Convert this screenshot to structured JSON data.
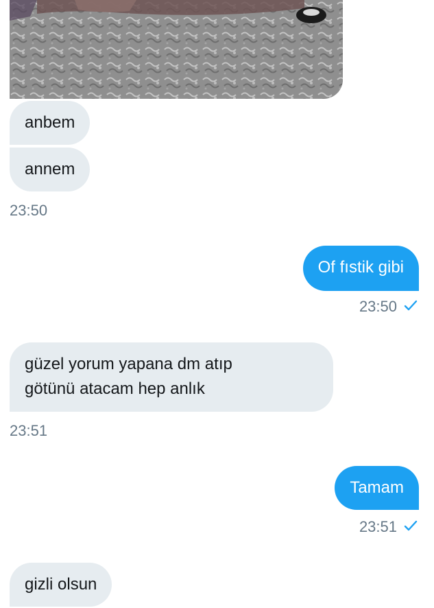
{
  "conversation": {
    "image_message": {
      "label": "photo-attachment"
    },
    "messages": [
      {
        "text": "anbem"
      },
      {
        "text": "annem"
      },
      {
        "time": "23:50"
      },
      {
        "text": "Of fıstik gibi",
        "time": "23:50"
      },
      {
        "line1": "güzel yorum yapana dm atıp",
        "line2": "götünü atacam hep anlık",
        "time": "23:51"
      },
      {
        "text": "Tamam",
        "time": "23:51"
      },
      {
        "text": "gizli olsun"
      }
    ]
  },
  "colors": {
    "incoming_bg": "#e6ecf0",
    "outgoing_bg": "#1da1f2",
    "timestamp": "#657786",
    "read_check": "#1da1f2"
  },
  "icons": {
    "read_receipt": "check-icon"
  }
}
